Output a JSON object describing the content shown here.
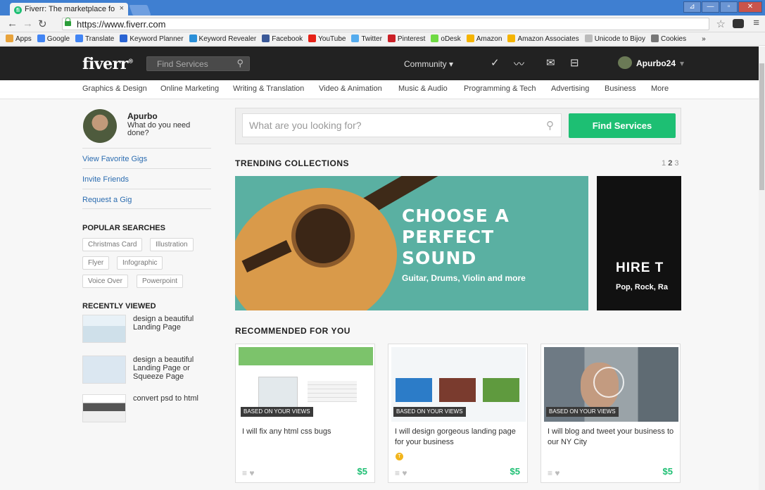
{
  "browser": {
    "tab_title": "Fiverr: The marketplace fo",
    "tab_close": "×",
    "url": "https://www.fiverr.com",
    "window_buttons": [
      "⊿",
      "—",
      "▫",
      "✕"
    ],
    "bookmarks": [
      {
        "label": "Apps",
        "color": "#e8a33b"
      },
      {
        "label": "Google",
        "color": "#4285f4"
      },
      {
        "label": "Translate",
        "color": "#4285f4"
      },
      {
        "label": "Keyword Planner",
        "color": "#2a64d3"
      },
      {
        "label": "Keyword Revealer",
        "color": "#2a8fd8"
      },
      {
        "label": "Facebook",
        "color": "#3b5998"
      },
      {
        "label": "YouTube",
        "color": "#e62117"
      },
      {
        "label": "Twitter",
        "color": "#55acee"
      },
      {
        "label": "Pinterest",
        "color": "#cb2027"
      },
      {
        "label": "oDesk",
        "color": "#6fda44"
      },
      {
        "label": "Amazon",
        "color": "#f5b400"
      },
      {
        "label": "Amazon Associates",
        "color": "#f5b400"
      },
      {
        "label": "Unicode to Bijoy",
        "color": "#bbbbbb"
      },
      {
        "label": "Cookies",
        "color": "#777777"
      },
      {
        "label": "»",
        "color": "transparent"
      }
    ]
  },
  "header": {
    "logo": "fiverr",
    "logo_mark": "®",
    "search_placeholder": "Find Services",
    "community": "Community ▾",
    "username": "Apurbo24",
    "user_caret": "▾"
  },
  "categories": [
    "Graphics & Design",
    "Online Marketing",
    "Writing & Translation",
    "Video & Animation",
    "Music & Audio",
    "Programming & Tech",
    "Advertising",
    "Business",
    "More"
  ],
  "sidebar": {
    "name": "Apurbo",
    "question": "What do you need done?",
    "links": [
      "View Favorite Gigs",
      "Invite Friends",
      "Request a Gig"
    ],
    "popular_title": "POPULAR SEARCHES",
    "popular": [
      "Christmas Card",
      "Illustration",
      "Flyer",
      "Infographic",
      "Voice Over",
      "Powerpoint"
    ],
    "recent_title": "RECENTLY VIEWED",
    "recent": [
      "design a beautiful Landing Page",
      "design a beautiful Landing Page or Squeeze Page",
      "convert psd to html"
    ]
  },
  "search": {
    "placeholder": "What are you looking for?",
    "button": "Find Services"
  },
  "trending": {
    "title": "TRENDING COLLECTIONS",
    "pager": [
      "1",
      "2",
      "3"
    ],
    "banner1_title": [
      "CHOOSE A",
      "PERFECT",
      "SOUND"
    ],
    "banner1_sub": "Guitar, Drums, Violin and more",
    "banner2_title": "HIRE T",
    "banner2_sub": "Pop, Rock, Ra"
  },
  "recommended": {
    "title": "RECOMMENDED FOR YOU",
    "cards": [
      {
        "badge": "BASED ON YOUR VIEWS",
        "title": "I will fix any html css bugs",
        "price": "$5",
        "level": ""
      },
      {
        "badge": "BASED ON YOUR VIEWS",
        "title": "I will design gorgeous landing page for your business",
        "price": "$5",
        "level": "T"
      },
      {
        "badge": "BASED ON YOUR VIEWS",
        "title": "I will blog and tweet your business to our NY City",
        "price": "$5",
        "level": ""
      }
    ],
    "card_actions": "≡ ♥"
  },
  "colors": {
    "brand_green": "#1dbf73",
    "header_bg": "#222222",
    "banner_teal": "#5ab0a2"
  }
}
